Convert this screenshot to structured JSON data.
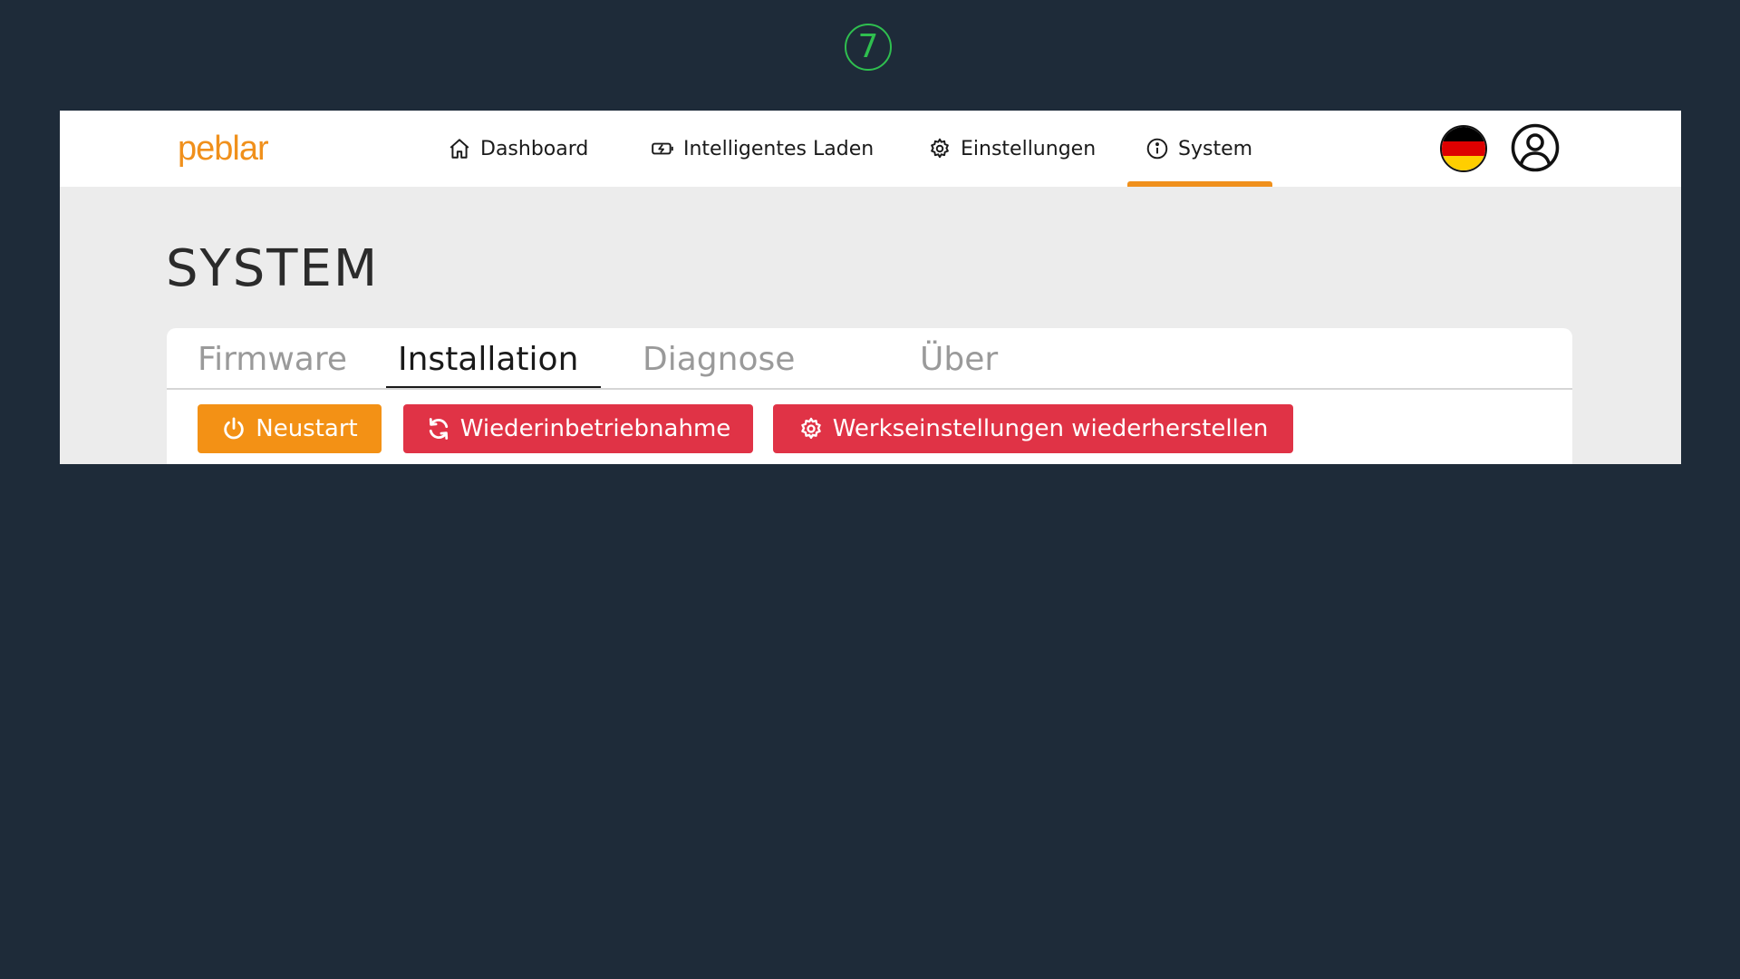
{
  "step": {
    "number": "7",
    "color": "#2fbf4f"
  },
  "header": {
    "logo_text": "peblar",
    "nav": [
      {
        "label": "Dashboard",
        "icon": "home-icon"
      },
      {
        "label": "Intelligentes Laden",
        "icon": "smart-charging-icon"
      },
      {
        "label": "Einstellungen",
        "icon": "gear-icon"
      },
      {
        "label": "System",
        "icon": "info-icon",
        "active": true
      }
    ],
    "language_icon": "german-flag-icon",
    "account_icon": "user-circle-icon"
  },
  "page": {
    "title": "SYSTEM"
  },
  "tabs": [
    {
      "label": "Firmware"
    },
    {
      "label": "Installation",
      "active": true
    },
    {
      "label": "Diagnose"
    },
    {
      "label": "Über"
    }
  ],
  "actions": [
    {
      "label": "Neustart",
      "icon": "power-icon",
      "color": "#f39115"
    },
    {
      "label": "Wiederinbetriebnahme",
      "icon": "refresh-icon",
      "color": "#e03346"
    },
    {
      "label": "Werkseinstellungen wiederherstellen",
      "icon": "gear-icon",
      "color": "#e03346"
    }
  ],
  "colors": {
    "accent": "#f0901c",
    "background": "#1e2b39",
    "content_bg": "#ececec"
  }
}
